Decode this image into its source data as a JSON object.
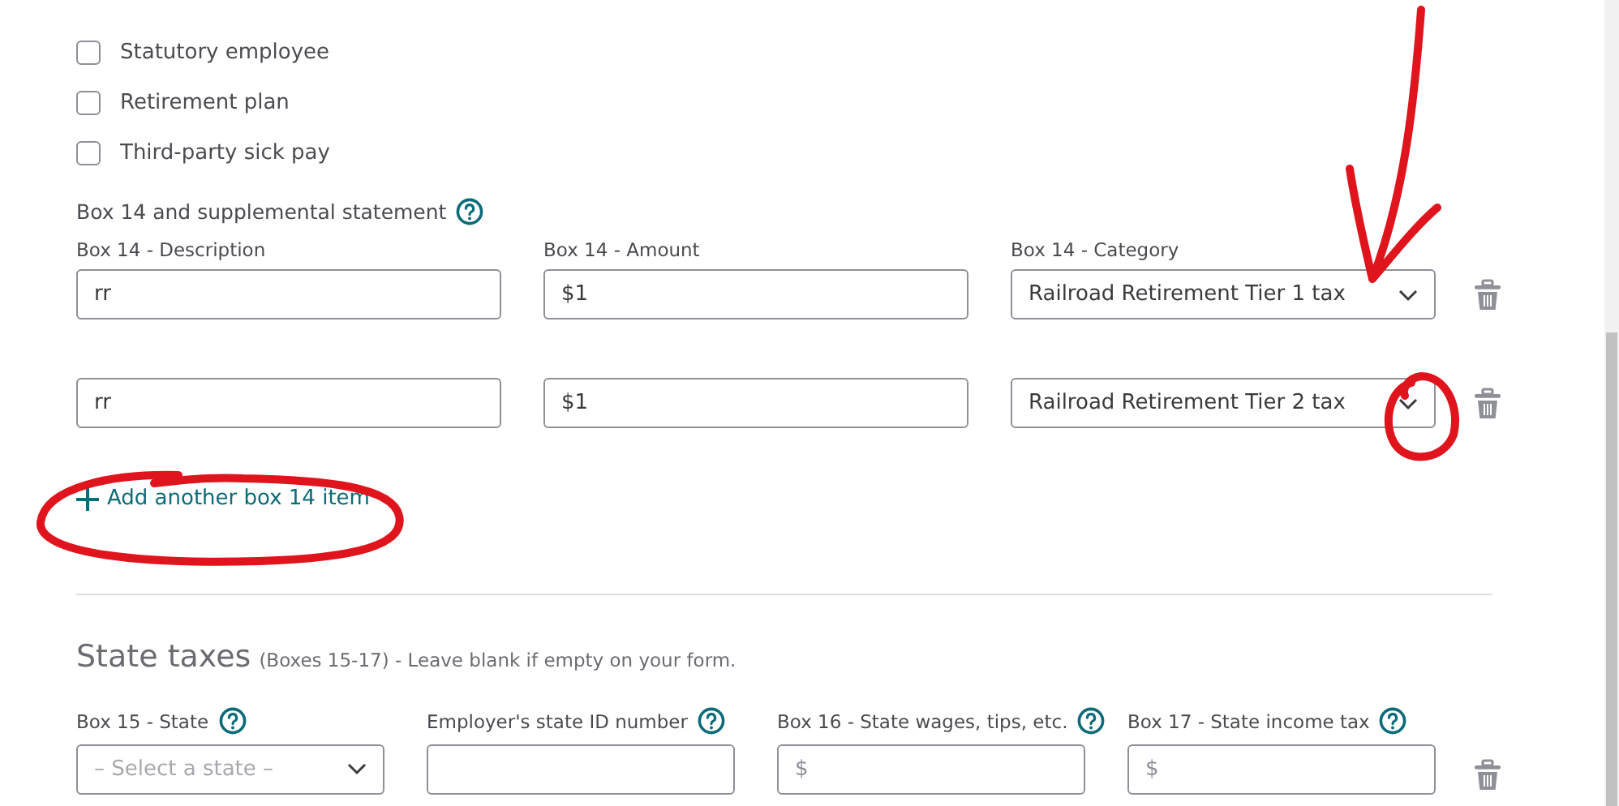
{
  "checkboxes": [
    {
      "label": "Statutory employee",
      "checked": false
    },
    {
      "label": "Retirement plan",
      "checked": false
    },
    {
      "label": "Third-party sick pay",
      "checked": false
    }
  ],
  "box14": {
    "title": "Box 14 and supplemental statement",
    "help": true,
    "columns": [
      "Box 14 - Description",
      "Box 14 - Amount",
      "Box 14 - Category"
    ],
    "rows": [
      {
        "description": "rr",
        "amount": "$1",
        "category": "Railroad Retirement Tier 1 tax"
      },
      {
        "description": "rr",
        "amount": "$1",
        "category": "Railroad Retirement Tier 2 tax"
      }
    ],
    "add_link": "Add another box 14 item"
  },
  "state_taxes": {
    "title": "State taxes",
    "subtitle": "(Boxes 15-17) - Leave blank if empty on your form.",
    "fields": [
      {
        "label": "Box 15 - State",
        "kind": "select",
        "help": true,
        "placeholder": "– Select a state –"
      },
      {
        "label": "Employer's state ID number",
        "kind": "text",
        "help": true
      },
      {
        "label": "Box 16 - State wages, tips, etc.",
        "kind": "text",
        "help": true,
        "placeholder": "$"
      },
      {
        "label": "Box 17 - State income tax",
        "kind": "text",
        "help": true,
        "placeholder": "$"
      }
    ]
  }
}
